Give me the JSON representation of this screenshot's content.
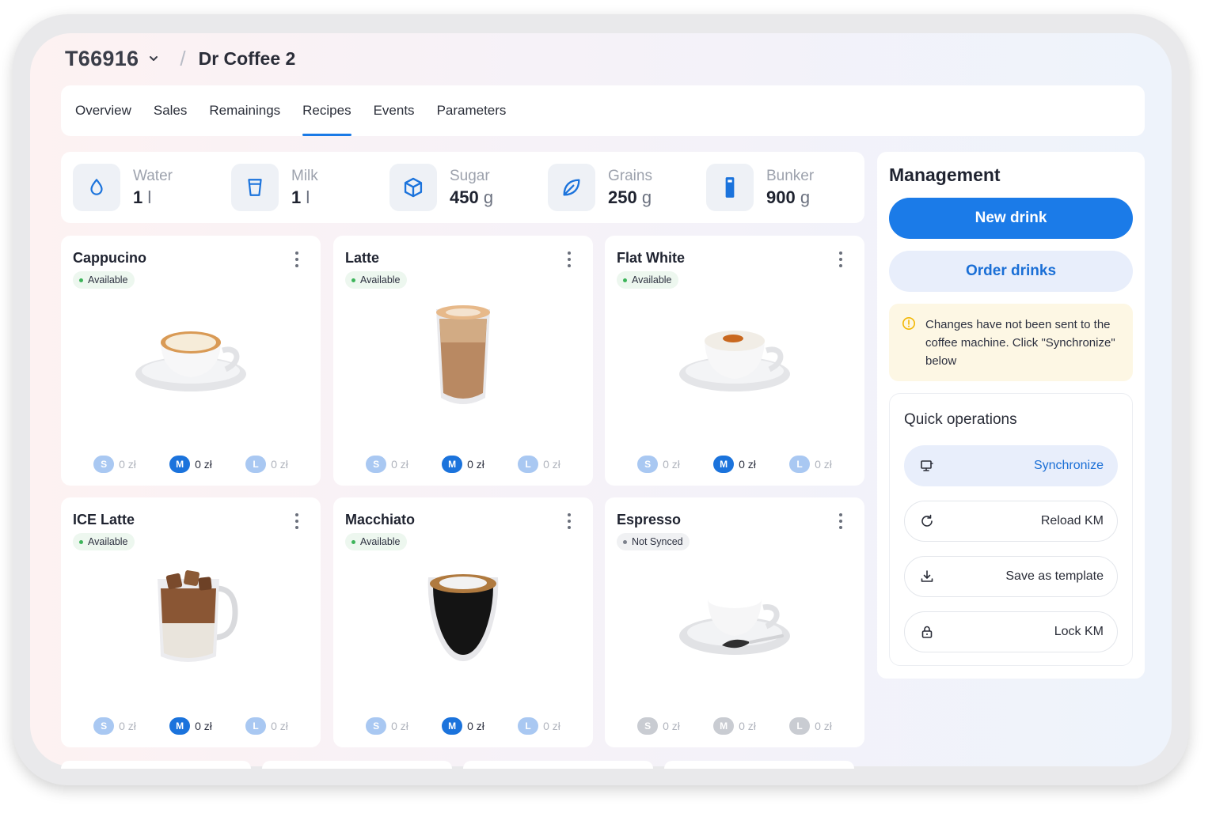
{
  "header": {
    "machine_id": "T66916",
    "separator": "/",
    "machine_name": "Dr Coffee 2"
  },
  "tabs": [
    {
      "label": "Overview"
    },
    {
      "label": "Sales"
    },
    {
      "label": "Remainings"
    },
    {
      "label": "Recipes",
      "active": true
    },
    {
      "label": "Events"
    },
    {
      "label": "Parameters"
    }
  ],
  "resources": [
    {
      "name": "Water",
      "value": "1",
      "unit": "l",
      "icon": "water-drop-icon"
    },
    {
      "name": "Milk",
      "value": "1",
      "unit": "l",
      "icon": "cup-icon"
    },
    {
      "name": "Sugar",
      "value": "450",
      "unit": "g",
      "icon": "cube-icon"
    },
    {
      "name": "Grains",
      "value": "250",
      "unit": "g",
      "icon": "leaf-icon"
    },
    {
      "name": "Bunker",
      "value": "900",
      "unit": "g",
      "icon": "bunker-icon"
    }
  ],
  "drinks": [
    {
      "name": "Cappucino",
      "status": "Available",
      "image": "cappuccino-cup",
      "sizes": [
        {
          "label": "S",
          "price": "0 zł"
        },
        {
          "label": "M",
          "price": "0 zł"
        },
        {
          "label": "L",
          "price": "0 zł"
        }
      ]
    },
    {
      "name": "Latte",
      "status": "Available",
      "image": "latte-glass",
      "sizes": [
        {
          "label": "S",
          "price": "0 zł"
        },
        {
          "label": "M",
          "price": "0 zł"
        },
        {
          "label": "L",
          "price": "0 zł"
        }
      ]
    },
    {
      "name": "Flat White",
      "status": "Available",
      "image": "flat-white-cup",
      "sizes": [
        {
          "label": "S",
          "price": "0 zł"
        },
        {
          "label": "M",
          "price": "0 zł"
        },
        {
          "label": "L",
          "price": "0 zł"
        }
      ]
    },
    {
      "name": "ICE Latte",
      "status": "Available",
      "image": "ice-latte-mug",
      "sizes": [
        {
          "label": "S",
          "price": "0 zł"
        },
        {
          "label": "M",
          "price": "0 zł"
        },
        {
          "label": "L",
          "price": "0 zł"
        }
      ]
    },
    {
      "name": "Macchiato",
      "status": "Available",
      "image": "macchiato-glass",
      "sizes": [
        {
          "label": "S",
          "price": "0 zł"
        },
        {
          "label": "M",
          "price": "0 zł"
        },
        {
          "label": "L",
          "price": "0 zł"
        }
      ]
    },
    {
      "name": "Espresso",
      "status": "Not Synced",
      "image": "espresso-cup",
      "sizes": [
        {
          "label": "S",
          "price": "0 zł"
        },
        {
          "label": "M",
          "price": "0 zł"
        },
        {
          "label": "L",
          "price": "0 zł"
        }
      ]
    }
  ],
  "management": {
    "title": "Management",
    "new_drink": "New drink",
    "order_drinks": "Order drinks",
    "warning": "Changes have not been sent to the coffee machine. Click \"Synchronize\" below",
    "quick_title": "Quick operations",
    "operations": [
      {
        "label": "Synchronize",
        "icon": "sync-screen-icon"
      },
      {
        "label": "Reload KM",
        "icon": "reload-icon"
      },
      {
        "label": "Save as template",
        "icon": "download-icon"
      },
      {
        "label": "Lock KM",
        "icon": "lock-icon"
      }
    ]
  },
  "colors": {
    "accent": "#1b7be8",
    "accent_light": "#e8eefb",
    "available": "#3db45a",
    "warning_bg": "#fdf7e4",
    "warning_icon": "#f2b705"
  }
}
